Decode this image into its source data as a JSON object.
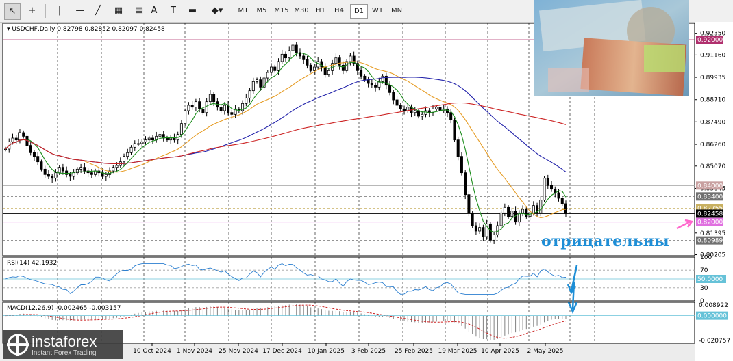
{
  "toolbar": {
    "tools": [
      {
        "name": "cursor-icon",
        "glyph": "↖"
      },
      {
        "name": "crosshair-icon",
        "glyph": "+"
      },
      {
        "name": "vertical-line-icon",
        "glyph": "|"
      },
      {
        "name": "horizontal-line-icon",
        "glyph": "—"
      },
      {
        "name": "trendline-icon",
        "glyph": "╱"
      },
      {
        "name": "channel-icon",
        "glyph": "▦"
      },
      {
        "name": "fibonacci-icon",
        "glyph": "▤"
      },
      {
        "name": "text-icon",
        "glyph": "A"
      },
      {
        "name": "text-label-icon",
        "glyph": "T"
      },
      {
        "name": "rectangle-icon",
        "glyph": "▬"
      },
      {
        "name": "shapes-icon",
        "glyph": "◆▾"
      }
    ],
    "timeframes": [
      "M1",
      "M5",
      "M15",
      "M30",
      "H1",
      "H4",
      "D1",
      "W1",
      "MN"
    ],
    "active_timeframe": "D1"
  },
  "chart_header": "USDCHF,Daily  0.82798 0.82852 0.82097 0.82458",
  "rsi_header": "RSI(14) 42.1932",
  "macd_header": "MACD(12,26,9) -0.002465 -0.003157",
  "annotation_text": "отрицательны",
  "logo": {
    "name": "instaforex",
    "sub": "Instant Forex Trading"
  },
  "colors": {
    "price_bg": "#ffffff",
    "candle": "#000000",
    "ma_fast": "#1a8c1a",
    "ma_mid": "#e69c24",
    "ma_slow": "#2222aa",
    "ma_long": "#cc2222",
    "rsi": "#2b7fd0",
    "macd_hist": "#808080",
    "macd_signal": "#cc2222",
    "arrow": "#1e8ed6",
    "pink_arrow": "#ff66cc"
  },
  "chart_data": {
    "type": "candlestick",
    "symbol": "USDCHF",
    "timeframe": "Daily",
    "ohlc_last": {
      "open": 0.82798,
      "high": 0.82852,
      "low": 0.82097,
      "close": 0.82458
    },
    "x_labels": [
      "10 Oct 2024",
      "1 Nov 2024",
      "25 Nov 2024",
      "17 Dec 2024",
      "10 Jan 2025",
      "3 Feb 2025",
      "25 Feb 2025",
      "19 Mar 2025",
      "10 Apr 2025",
      "2 May 2025"
    ],
    "y_ticks": [
      0.9235,
      0.9116,
      0.89935,
      0.8871,
      0.8749,
      0.8626,
      0.8507,
      0.83845,
      0.81395,
      0.80205
    ],
    "y_range": [
      0.8015,
      0.929
    ],
    "price_levels": [
      {
        "value": 0.92,
        "label": "0.92000",
        "color": "#b0306e",
        "bg": "#b0306e",
        "style": "solid"
      },
      {
        "value": 0.84,
        "label": "0.84000",
        "color": "#a0a0a0",
        "bg": "#c8a0a0",
        "style": "solid"
      },
      {
        "value": 0.834,
        "label": "0.83400",
        "color": "#707070",
        "bg": "#707070",
        "style": "dashed"
      },
      {
        "value": 0.82755,
        "label": "0.82755",
        "color": "#c8b060",
        "bg": "#c8b060",
        "style": "dashed"
      },
      {
        "value": 0.82458,
        "label": "0.82458",
        "color": "#000000",
        "bg": "#000000",
        "style": "solid"
      },
      {
        "value": 0.82,
        "label": "0.82000",
        "color": "#e070e0",
        "bg": "#e070e0",
        "style": "solid"
      },
      {
        "value": 0.80989,
        "label": "0.80989",
        "color": "#707070",
        "bg": "#707070",
        "style": "dashed"
      }
    ],
    "close_series": [
      0.86,
      0.864,
      0.866,
      0.865,
      0.869,
      0.867,
      0.862,
      0.858,
      0.856,
      0.853,
      0.849,
      0.846,
      0.845,
      0.844,
      0.847,
      0.85,
      0.848,
      0.846,
      0.845,
      0.847,
      0.849,
      0.85,
      0.848,
      0.847,
      0.846,
      0.848,
      0.847,
      0.845,
      0.846,
      0.848,
      0.85,
      0.851,
      0.853,
      0.856,
      0.858,
      0.861,
      0.863,
      0.863,
      0.864,
      0.865,
      0.866,
      0.865,
      0.867,
      0.868,
      0.866,
      0.865,
      0.866,
      0.865,
      0.868,
      0.874,
      0.881,
      0.884,
      0.883,
      0.886,
      0.882,
      0.88,
      0.886,
      0.89,
      0.886,
      0.883,
      0.881,
      0.884,
      0.88,
      0.879,
      0.882,
      0.881,
      0.885,
      0.888,
      0.892,
      0.897,
      0.898,
      0.894,
      0.899,
      0.902,
      0.905,
      0.903,
      0.908,
      0.912,
      0.91,
      0.914,
      0.917,
      0.913,
      0.911,
      0.909,
      0.906,
      0.903,
      0.905,
      0.908,
      0.905,
      0.901,
      0.903,
      0.907,
      0.91,
      0.906,
      0.903,
      0.908,
      0.911,
      0.907,
      0.903,
      0.9,
      0.898,
      0.896,
      0.895,
      0.894,
      0.897,
      0.9,
      0.895,
      0.891,
      0.887,
      0.884,
      0.882,
      0.881,
      0.883,
      0.88,
      0.881,
      0.878,
      0.879,
      0.881,
      0.88,
      0.882,
      0.883,
      0.881,
      0.882,
      0.88,
      0.876,
      0.865,
      0.856,
      0.847,
      0.835,
      0.825,
      0.818,
      0.815,
      0.817,
      0.812,
      0.819,
      0.81,
      0.813,
      0.818,
      0.825,
      0.828,
      0.823,
      0.826,
      0.82,
      0.825,
      0.827,
      0.823,
      0.825,
      0.829,
      0.825,
      0.832,
      0.844,
      0.84,
      0.838,
      0.836,
      0.833,
      0.83,
      0.8246
    ],
    "moving_averages": [
      {
        "name": "MA fast",
        "color": "#1a8c1a"
      },
      {
        "name": "MA mid",
        "color": "#e69c24"
      },
      {
        "name": "MA slow",
        "color": "#2222aa"
      },
      {
        "name": "MA long",
        "color": "#cc2222"
      }
    ],
    "rsi": {
      "period": 14,
      "value": 42.1932,
      "levels": [
        100,
        70,
        50,
        30,
        0
      ],
      "level_label": "50.0000"
    },
    "macd": {
      "params": [
        12,
        26,
        9
      ],
      "main": -0.002465,
      "signal": -0.003157,
      "y_ticks": [
        0.008922,
        0.0,
        -0.020757
      ],
      "zero_label": "0.000000"
    }
  }
}
